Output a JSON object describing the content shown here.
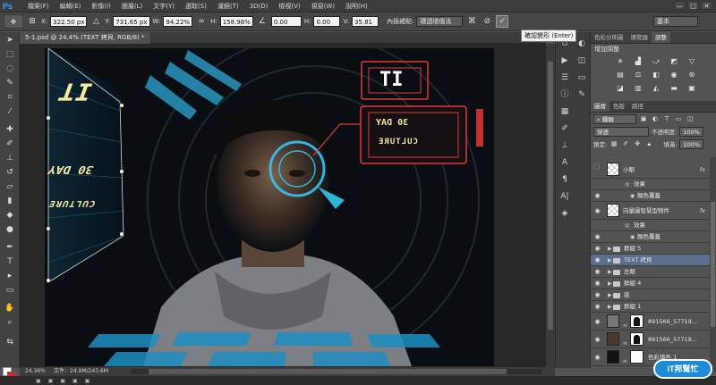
{
  "app": {
    "logo": "Ps",
    "menu": [
      "檔案(F)",
      "編輯(E)",
      "影像(I)",
      "圖層(L)",
      "文字(Y)",
      "選取(S)",
      "濾鏡(T)",
      "3D(D)",
      "檢視(V)",
      "視窗(W)",
      "說明(H)"
    ],
    "window_controls": [
      "—",
      "□",
      "✕"
    ]
  },
  "options": {
    "x_label": "X:",
    "x_value": "322.50 px",
    "y_label": "Y:",
    "y_value": "731.65 px",
    "w_label": "W:",
    "w_value": "94.22%",
    "h_label": "H:",
    "h_value": "158.98%",
    "angle_value": "0.00",
    "hskew_label": "H:",
    "hskew_value": "0.00",
    "vskew_label": "V:",
    "vskew_value": "35.81",
    "interp_label": "內插補點:",
    "interp_value": "環迴增值法",
    "workspace": "基本",
    "tooltip": "確認變形 (Enter)"
  },
  "document": {
    "tab_title": "5-1.psd @ 24.4% (TEXT 拷貝, RGB/8) *",
    "zoom": "24.36%",
    "file_info": "文件：24.9M/243.6M",
    "artwork_text": {
      "it_left": "IT",
      "day_left": "30 DAY",
      "culture_left": "CULTURE",
      "it_box": "IT",
      "day_box": "30 DAY",
      "culture_box": "CULTURE"
    }
  },
  "panels": {
    "top_tabs": [
      "色彩分佈圖",
      "導覽器",
      "調整"
    ],
    "adjust_title": "增加調整",
    "layer_tabs": [
      "圖層",
      "色版",
      "路徑"
    ],
    "filter_kind": "種類",
    "blend_mode": "穿透",
    "opacity_label": "不透明度:",
    "opacity_value": "100%",
    "lock_label": "鎖定:",
    "fill_label": "填滿:",
    "fill_value": "100%",
    "layers": [
      {
        "name": "小眼",
        "kind": "smart",
        "visible": false,
        "fx": "fx"
      },
      {
        "name": "效果",
        "kind": "effect"
      },
      {
        "name": "顏色覆蓋",
        "kind": "effect2"
      },
      {
        "name": "向量圖智慧型物件",
        "kind": "smart",
        "visible": true,
        "fx": "fx"
      },
      {
        "name": "效果",
        "kind": "effect"
      },
      {
        "name": "顏色覆蓋",
        "kind": "effect2"
      },
      {
        "name": "群組 5",
        "kind": "group",
        "visible": true
      },
      {
        "name": "TEXT 拷貝",
        "kind": "group",
        "visible": true,
        "selected": true
      },
      {
        "name": "左眼",
        "kind": "group",
        "visible": true
      },
      {
        "name": "群組 4",
        "kind": "group",
        "visible": true
      },
      {
        "name": "底",
        "kind": "group",
        "visible": true
      },
      {
        "name": "群組 1",
        "kind": "group",
        "visible": true
      },
      {
        "name": "891566_57719...",
        "kind": "masked",
        "visible": true
      },
      {
        "name": "891566_57719...",
        "kind": "masked-photo",
        "visible": true
      },
      {
        "name": "色彩填色 1",
        "kind": "fill",
        "visible": true
      }
    ]
  },
  "watermark": "iT邦幫忙",
  "colors": {
    "foreground": "#ffffff",
    "background": "#e02020",
    "selection": "#5b6f8c"
  }
}
